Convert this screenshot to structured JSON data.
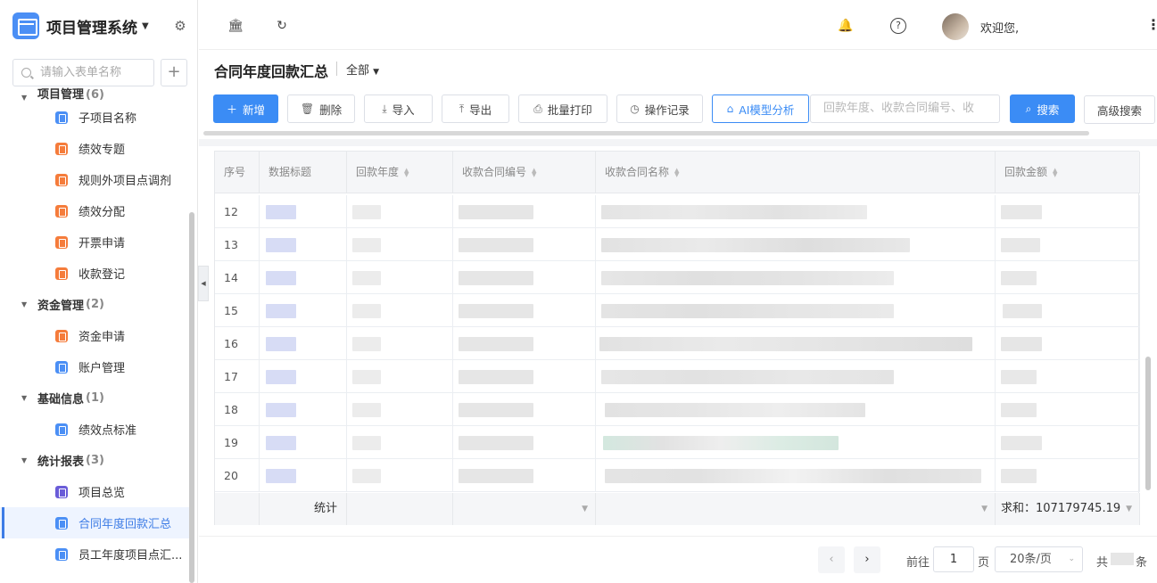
{
  "app": {
    "title": "项目管理系统",
    "welcome": "欢迎您,"
  },
  "sidebar": {
    "search_placeholder": "请输入表单名称",
    "add_label": "+",
    "groups": [
      {
        "label": "项目管理",
        "count": "(6)",
        "items": [
          "子项目名称",
          "绩效专题",
          "规则外项目点调剂",
          "绩效分配",
          "开票申请",
          "收款登记"
        ]
      },
      {
        "label": "资金管理",
        "count": "(2)",
        "items": [
          "资金申请",
          "账户管理"
        ]
      },
      {
        "label": "基础信息",
        "count": "(1)",
        "items": [
          "绩效点标准"
        ]
      },
      {
        "label": "统计报表",
        "count": "(3)",
        "items": [
          "项目总览",
          "合同年度回款汇总",
          "员工年度项目点汇..."
        ]
      }
    ]
  },
  "page": {
    "title": "合同年度回款汇总",
    "filter": "全部"
  },
  "toolbar": {
    "new": "新增",
    "delete": "删除",
    "import": "导入",
    "export": "导出",
    "batch_print": "批量打印",
    "op_log": "操作记录",
    "ai": "AI模型分析",
    "search_placeholder": "回款年度、收款合同编号、收",
    "search": "搜索",
    "advanced": "高级搜索"
  },
  "table": {
    "columns": [
      "序号",
      "数据标题",
      "回款年度",
      "收款合同编号",
      "收款合同名称",
      "回款金额"
    ],
    "rows": [
      "12",
      "13",
      "14",
      "15",
      "16",
      "17",
      "18",
      "19",
      "20"
    ],
    "footer_label": "统计",
    "footer_sum": "求和：107179745.19"
  },
  "pagination": {
    "goto": "前往",
    "page_num": "1",
    "page_unit": "页",
    "page_size": "20条/页",
    "total_prefix": "共",
    "total_suffix": "条"
  },
  "colors": {
    "primary": "#3b8cf5",
    "accent_blue_icon": "#4b8ff5",
    "accent_orange_icon": "#f57c3b",
    "accent_purple_icon": "#6a5cd8"
  }
}
